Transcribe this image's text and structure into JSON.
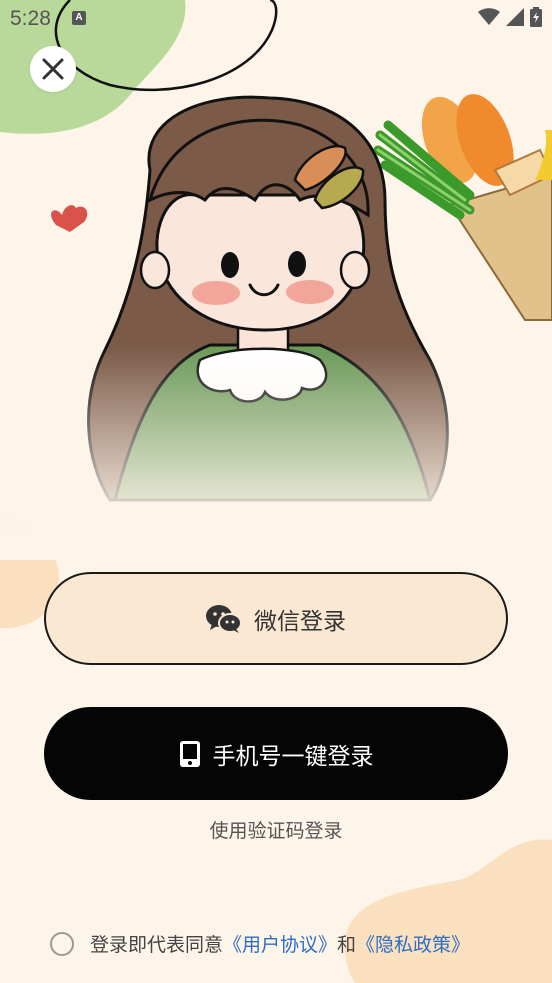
{
  "status_bar": {
    "time": "5:28",
    "indicator": "A",
    "icons": [
      "wifi-icon",
      "signal-icon",
      "battery-icon"
    ]
  },
  "close_button": {
    "icon": "close-icon"
  },
  "hero": {
    "icon": "girl-illustration"
  },
  "buttons": {
    "wechat_label": "微信登录",
    "wechat_icon": "wechat-icon",
    "phone_label": "手机号一键登录",
    "phone_icon": "phone-icon"
  },
  "sms_login_label": "使用验证码登录",
  "agreement": {
    "prefix": "登录即代表同意",
    "user_agreement": "《用户协议》",
    "and": "和",
    "privacy_policy": "《隐私政策》"
  },
  "colors": {
    "background": "#fdf4ea",
    "wechat_button_bg": "#fbe8d2",
    "phone_button_bg": "#050505",
    "link": "#2c6fc4"
  }
}
